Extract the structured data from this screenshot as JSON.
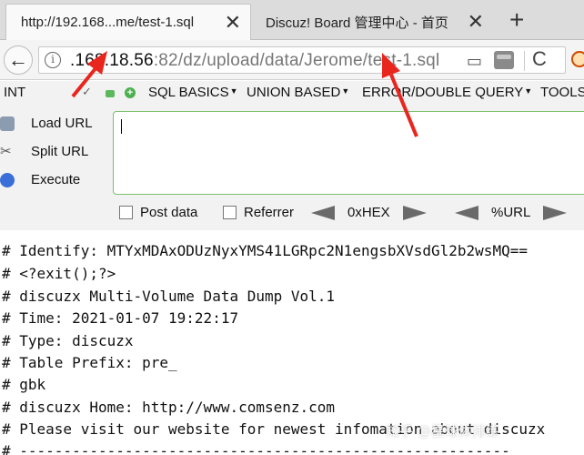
{
  "tabs": [
    {
      "title": "http://192.168...me/test-1.sql",
      "close": "✕"
    },
    {
      "title": "Discuz! Board 管理中心 - 首页",
      "close": "✕"
    }
  ],
  "new_tab": "+",
  "navbar": {
    "back": "←",
    "info": "i",
    "url_host": ".168.18.56",
    "url_path": ":82/dz/upload/data/Jerome/test-1.sql",
    "reload": "C"
  },
  "hackbar": {
    "select_value": "INT",
    "menus": [
      "SQL BASICS",
      "UNION BASED",
      "ERROR/DOUBLE QUERY",
      "TOOLS"
    ],
    "side_buttons": [
      "Load URL",
      "Split URL",
      "Execute"
    ],
    "options": [
      "Post data",
      "Referrer"
    ],
    "encoders": [
      "0xHEX",
      "%URL"
    ]
  },
  "dump_lines": [
    "# Identify: MTYxMDAxODUzNyxYMS41LGRpc2N1engsbXVsdGl2b2wsMQ==",
    "# <?exit();?>",
    "# discuzx Multi-Volume Data Dump Vol.1",
    "# Time: 2021-01-07 19:22:17",
    "# Type: discuzx",
    "# Table Prefix: pre_",
    "# gbk",
    "# discuzx Home: http://www.comsenz.com",
    "# Please visit our website for newest infomation about discuzx",
    "# --------------------------------------------------------"
  ],
  "watermark": "知乎 @星球体排练",
  "colors": {
    "annotation_arrow": "#e8261e",
    "textarea_border": "#7bbf6a"
  }
}
